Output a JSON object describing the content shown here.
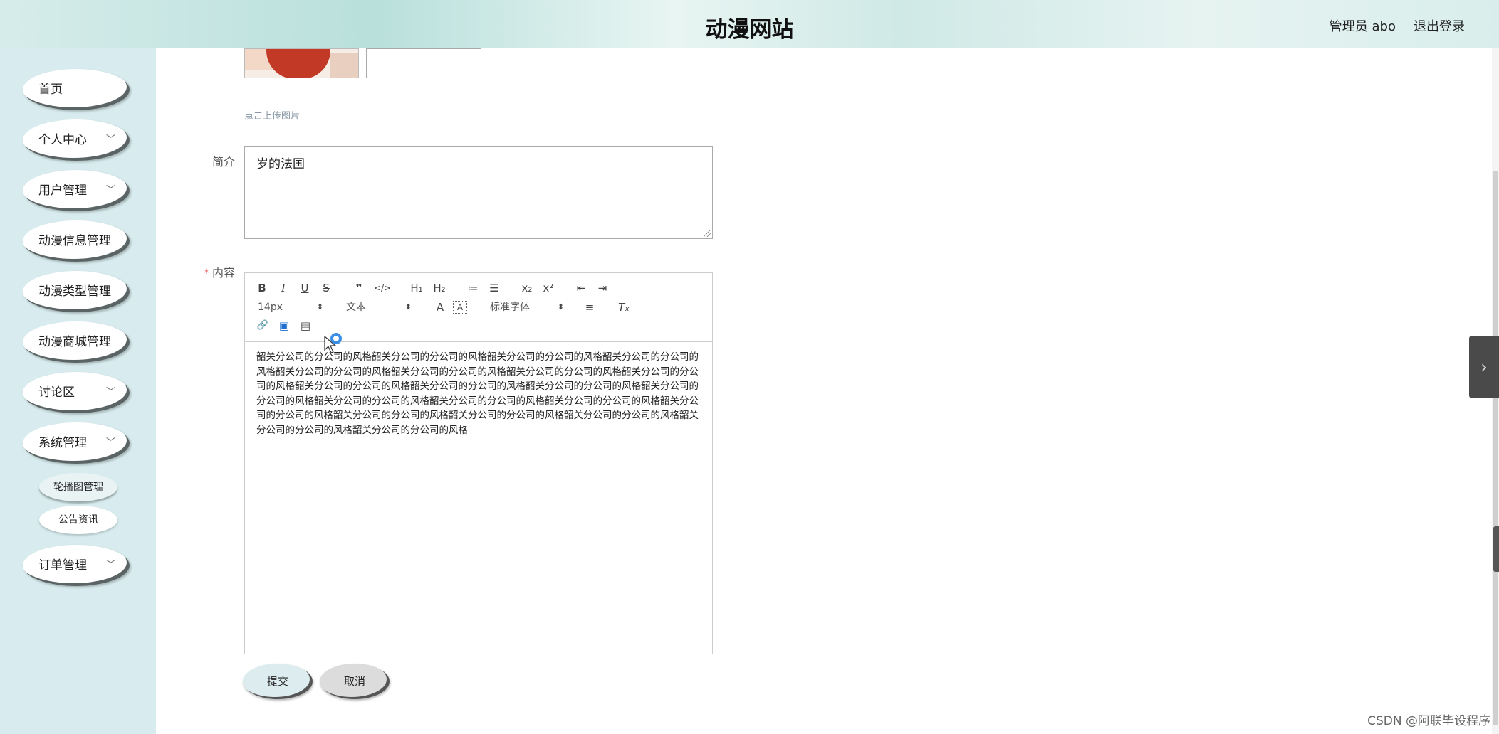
{
  "header": {
    "title": "动漫网站",
    "user": "管理员 abo",
    "logout": "退出登录"
  },
  "sidebar": {
    "items": [
      {
        "label": "首页",
        "expandable": false
      },
      {
        "label": "个人中心",
        "expandable": true
      },
      {
        "label": "用户管理",
        "expandable": true
      },
      {
        "label": "动漫信息管理",
        "expandable": false
      },
      {
        "label": "动漫类型管理",
        "expandable": false
      },
      {
        "label": "动漫商城管理",
        "expandable": false
      },
      {
        "label": "讨论区",
        "expandable": true
      },
      {
        "label": "系统管理",
        "expandable": true
      },
      {
        "label": "订单管理",
        "expandable": true
      }
    ],
    "subitems": [
      "轮播图管理",
      "公告资讯"
    ]
  },
  "form": {
    "upload_hint": "点击上传图片",
    "intro_label": "简介",
    "intro_value": "岁的法国",
    "content_label": "内容",
    "content_required_mark": "*",
    "content_text": "韶关分公司的分公司的风格韶关分公司的分公司的风格韶关分公司的分公司的风格韶关分公司的分公司的风格韶关分公司的分公司的风格韶关分公司的分公司的风格韶关分公司的分公司的风格韶关分公司的分公司的风格韶关分公司的分公司的风格韶关分公司的分公司的风格韶关分公司的分公司的风格韶关分公司的分公司的风格韶关分公司的分公司的风格韶关分公司的分公司的风格韶关分公司的分公司的风格韶关分公司的分公司的风格韶关分公司的分公司的风格韶关分公司的分公司的风格韶关分公司的分公司的风格韶关分公司的分公司的风格韶关分公司的分公司的风格",
    "submit": "提交",
    "cancel": "取消"
  },
  "toolbar": {
    "size": "14px",
    "format": "文本",
    "font": "标准字体",
    "bold": "B",
    "italic": "I",
    "underline": "U",
    "strike": "S",
    "quote": "❞",
    "code": "</>",
    "h1": "H₁",
    "h2": "H₂",
    "ordered": "≔",
    "bullet": "☰",
    "sub": "x₂",
    "sup": "x²",
    "outdent": "⇤",
    "indent": "⇥",
    "color": "A",
    "bgcolor": "A",
    "align": "≡",
    "clean": "Tₓ",
    "link": "🔗",
    "image": "▣",
    "video": "▤"
  },
  "side_tab": "›",
  "watermark": "CSDN @阿联毕设程序"
}
